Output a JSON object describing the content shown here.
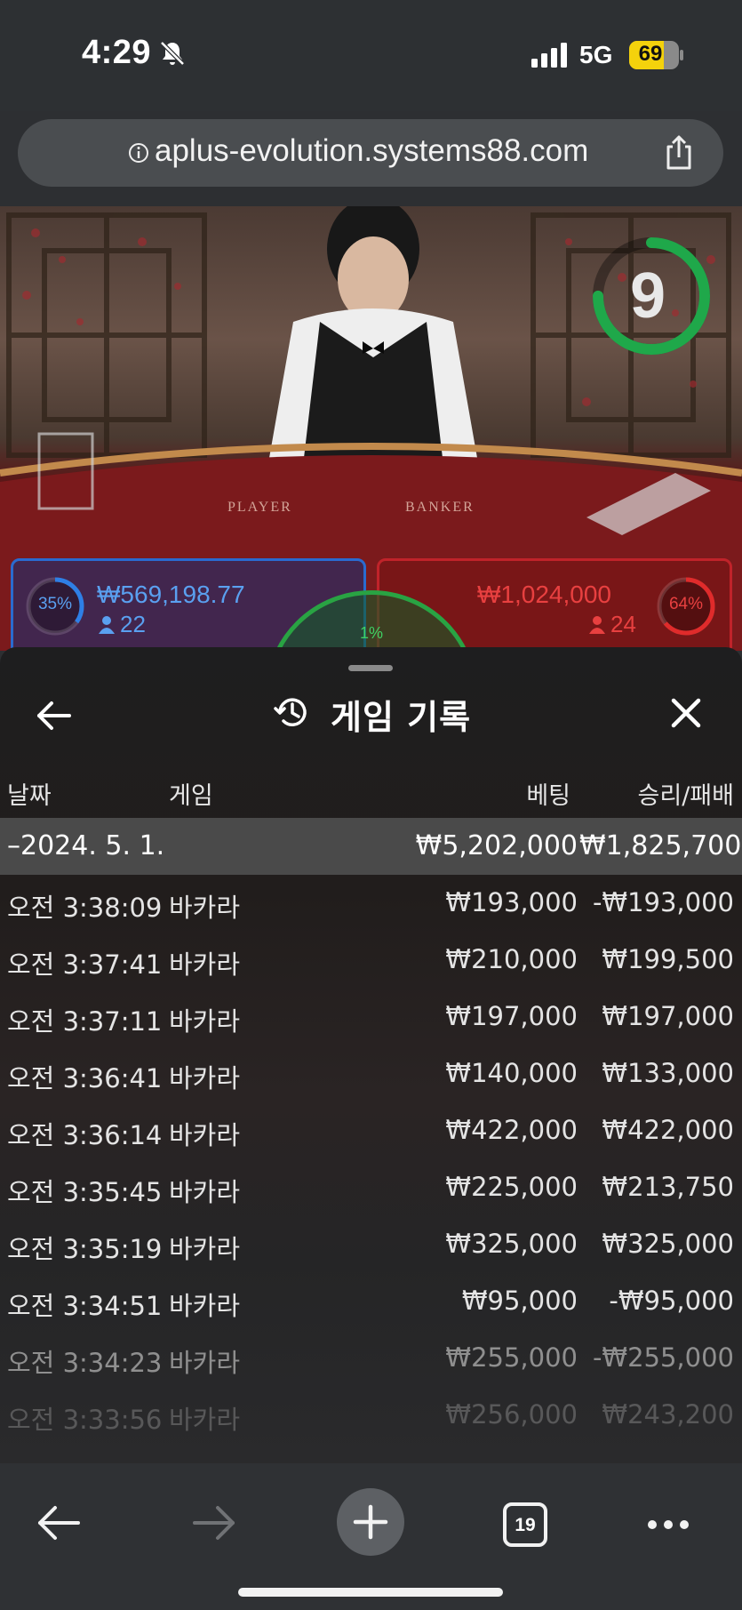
{
  "status_bar": {
    "time": "4:29",
    "network": "5G",
    "battery": "69",
    "battery_level": 0.69
  },
  "browser": {
    "url": "aplus-evolution.systems88.com",
    "tabs_count": "19"
  },
  "video": {
    "countdown": "9",
    "countdown_progress": 0.75,
    "table_labels": [
      "PLAYER",
      "BANKER"
    ],
    "player": {
      "percent": "35%",
      "amount": "₩569,198.77",
      "count": "22"
    },
    "banker": {
      "percent": "64%",
      "amount": "₩1,024,000",
      "count": "24"
    },
    "tie": {
      "percent": "1%"
    },
    "colors": {
      "player": "#2a6bd0",
      "banker": "#c0232a",
      "tie": "#29a343",
      "timer": "#1fa84a"
    }
  },
  "panel": {
    "title": "게임 기록",
    "headers": {
      "date": "날짜",
      "game": "게임",
      "bet": "베팅",
      "win_loss": "승리/패배"
    },
    "summary": {
      "date": "–2024. 5. 1.",
      "bet": "₩5,202,000",
      "win_loss": "₩1,825,700"
    },
    "rows": [
      {
        "time": "오전 3:38:09",
        "game": "바카라",
        "bet": "₩193,000",
        "result": "-₩193,000"
      },
      {
        "time": "오전 3:37:41",
        "game": "바카라",
        "bet": "₩210,000",
        "result": "₩199,500"
      },
      {
        "time": "오전 3:37:11",
        "game": "바카라",
        "bet": "₩197,000",
        "result": "₩197,000"
      },
      {
        "time": "오전 3:36:41",
        "game": "바카라",
        "bet": "₩140,000",
        "result": "₩133,000"
      },
      {
        "time": "오전 3:36:14",
        "game": "바카라",
        "bet": "₩422,000",
        "result": "₩422,000"
      },
      {
        "time": "오전 3:35:45",
        "game": "바카라",
        "bet": "₩225,000",
        "result": "₩213,750"
      },
      {
        "time": "오전 3:35:19",
        "game": "바카라",
        "bet": "₩325,000",
        "result": "₩325,000"
      },
      {
        "time": "오전 3:34:51",
        "game": "바카라",
        "bet": "₩95,000",
        "result": "-₩95,000"
      },
      {
        "time": "오전 3:34:23",
        "game": "바카라",
        "bet": "₩255,000",
        "result": "-₩255,000"
      },
      {
        "time": "오전 3:33:56",
        "game": "바카라",
        "bet": "₩256,000",
        "result": "₩243,200"
      }
    ]
  }
}
